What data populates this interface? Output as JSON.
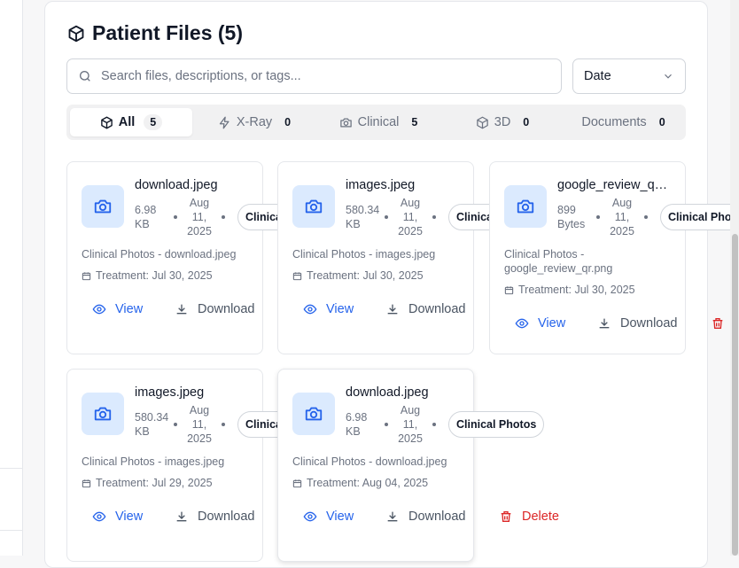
{
  "title": "Patient Files (5)",
  "search": {
    "placeholder": "Search files, descriptions, or tags..."
  },
  "sort": {
    "value": "Date"
  },
  "tabs": [
    {
      "label": "All",
      "count": "5"
    },
    {
      "label": "X-Ray",
      "count": "0"
    },
    {
      "label": "Clinical",
      "count": "5"
    },
    {
      "label": "3D",
      "count": "0"
    },
    {
      "label": "Documents",
      "count": "0"
    }
  ],
  "actions": {
    "view": "View",
    "download": "Download",
    "delete": "Delete"
  },
  "files": [
    {
      "name": "download.jpeg",
      "size": "6.98 KB",
      "date": "Aug 11, 2025",
      "tag": "Clinical Photos",
      "description": "Clinical Photos - download.jpeg",
      "treatment": "Treatment: Jul 30, 2025"
    },
    {
      "name": "images.jpeg",
      "size": "580.34 KB",
      "date": "Aug 11, 2025",
      "tag": "Clinical Photos",
      "description": "Clinical Photos - images.jpeg",
      "treatment": "Treatment: Jul 30, 2025"
    },
    {
      "name": "google_review_qr.png",
      "size": "899 Bytes",
      "date": "Aug 11, 2025",
      "tag": "Clinical Photos",
      "description": "Clinical Photos - google_review_qr.png",
      "treatment": "Treatment: Jul 30, 2025"
    },
    {
      "name": "images.jpeg",
      "size": "580.34 KB",
      "date": "Aug 11, 2025",
      "tag": "Clinical Photos",
      "description": "Clinical Photos - images.jpeg",
      "treatment": "Treatment: Jul 29, 2025"
    },
    {
      "name": "download.jpeg",
      "size": "6.98 KB",
      "date": "Aug 11, 2025",
      "tag": "Clinical Photos",
      "description": "Clinical Photos - download.jpeg",
      "treatment": "Treatment: Aug 04, 2025"
    }
  ],
  "colors": {
    "accent": "#2563eb",
    "danger": "#dc2626",
    "thumb_bg": "#dbeafe"
  }
}
